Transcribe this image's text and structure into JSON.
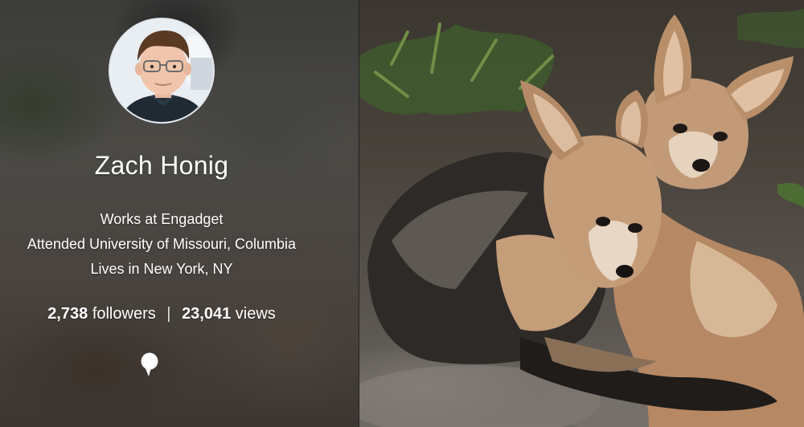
{
  "profile": {
    "name": "Zach Honig",
    "details": [
      "Works at Engadget",
      "Attended University of Missouri, Columbia",
      "Lives in New York, NY"
    ],
    "stats": {
      "followers_count": "2,738",
      "followers_label": "followers",
      "separator": "|",
      "views_count": "23,041",
      "views_label": "views"
    },
    "avatar_icon": "avatar-photo",
    "comment_icon": "speech-bubble-icon"
  },
  "cover_photo": {
    "subject_icon": "fox-pups-photo"
  },
  "colors": {
    "text": "#ffffff",
    "panel_background": "#4f4b46"
  }
}
